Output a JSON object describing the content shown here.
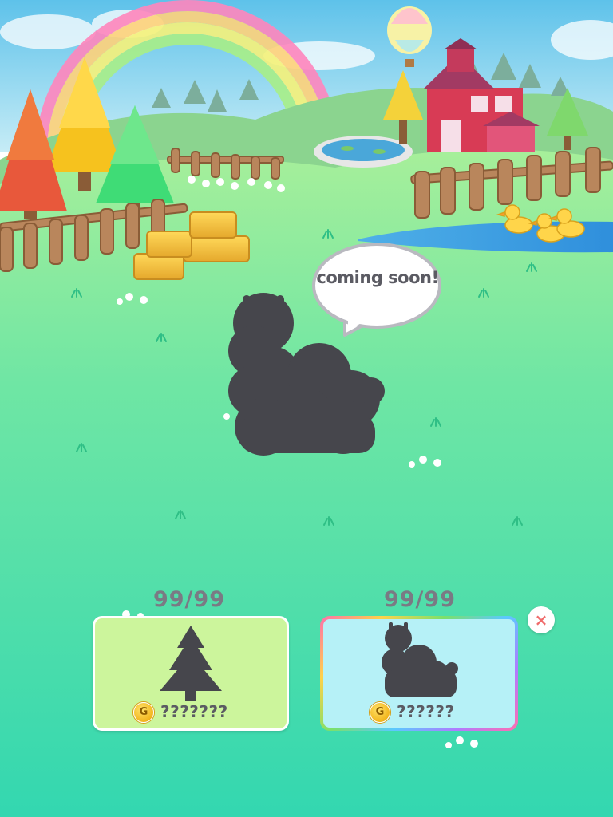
{
  "speech_bubble": {
    "text": "coming soon!"
  },
  "items": [
    {
      "name": "tree",
      "count": "99/99",
      "currency_icon": "gold-coin-icon",
      "currency_symbol": "G",
      "price": "???????",
      "locked": true
    },
    {
      "name": "alpaca",
      "count": "99/99",
      "currency_icon": "gold-coin-icon",
      "currency_symbol": "G",
      "price": "??????",
      "locked": true,
      "selected": true
    }
  ],
  "close_button": {
    "label": "×",
    "icon": "close-icon"
  },
  "colors": {
    "sky": "#8ed3ee",
    "grass": "#3ddba6",
    "silhouette": "#46464c",
    "tree_card": "#ccf59c",
    "alpaca_card": "#b6f1f7",
    "close_x": "#f06b6b"
  }
}
